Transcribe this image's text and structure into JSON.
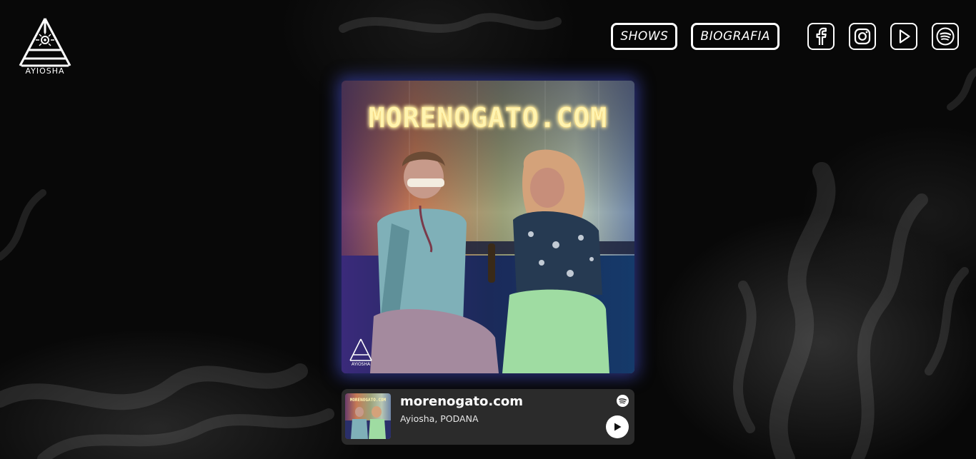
{
  "brand": {
    "logo_text": "AYIOSHA"
  },
  "nav": {
    "shows_label": "SHOWS",
    "bio_label": "BIOGRAFIA",
    "social": [
      {
        "icon": "facebook-icon"
      },
      {
        "icon": "instagram-icon"
      },
      {
        "icon": "youtube-play-icon"
      },
      {
        "icon": "spotify-icon"
      }
    ]
  },
  "cover": {
    "neon_title": "MORENOGATO.COM",
    "badge_text": "AYIOSHA"
  },
  "player": {
    "title": "morenogato.com",
    "artist": "Ayiosha, PODANA",
    "thumb_title": "MORENOGATO.COM"
  },
  "colors": {
    "background": "#080808",
    "glow": "#4650d2",
    "player_bg": "#2b2b2b",
    "neon": "#fff4b0"
  }
}
